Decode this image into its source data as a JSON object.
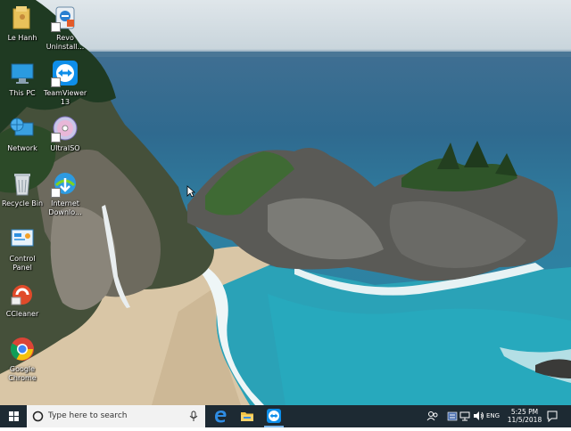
{
  "desktop": {
    "icons": [
      {
        "label": "Le Hanh",
        "icon": "user-folder-icon"
      },
      {
        "label": "Revo Uninstall...",
        "icon": "revo-uninstaller-icon"
      },
      {
        "label": "This PC",
        "icon": "computer-monitor-icon"
      },
      {
        "label": "TeamViewer 13",
        "icon": "teamviewer-icon"
      },
      {
        "label": "Network",
        "icon": "network-globe-icon"
      },
      {
        "label": "UltraISO",
        "icon": "disc-icon"
      },
      {
        "label": "Recycle Bin",
        "icon": "recycle-bin-icon"
      },
      {
        "label": "Internet Downlo...",
        "icon": "internet-download-manager-icon"
      },
      {
        "label": "Control Panel",
        "icon": "control-panel-icon"
      },
      {
        "label": "CCleaner",
        "icon": "ccleaner-icon"
      },
      {
        "label": "Google Chrome",
        "icon": "chrome-icon"
      }
    ]
  },
  "taskbar": {
    "search_placeholder": "Type here to search",
    "pinned_apps": [
      {
        "icon": "edge-icon"
      },
      {
        "icon": "file-explorer-icon"
      },
      {
        "icon": "teamviewer-icon"
      }
    ],
    "language": "ENG",
    "time": "5:25 PM",
    "date": "11/5/2018"
  },
  "colors": {
    "taskbar_bg": "#1d2a33",
    "search_bg": "#f2f2f2",
    "accent": "#0f7dd6"
  }
}
